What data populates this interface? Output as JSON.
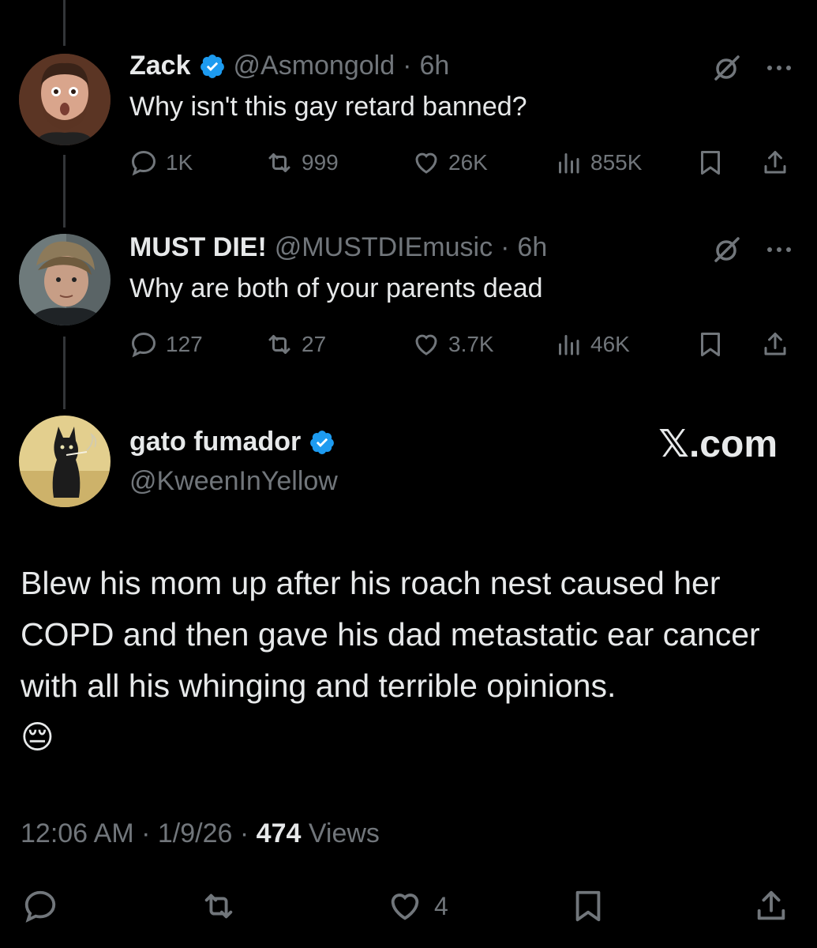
{
  "replies": [
    {
      "name": "Zack",
      "verified": true,
      "handle": "@Asmongold",
      "time": "6h",
      "text": "Why isn't this gay retard banned?",
      "stats": {
        "replies": "1K",
        "reposts": "999",
        "likes": "26K",
        "views": "855K"
      }
    },
    {
      "name": "MUST DIE!",
      "verified": false,
      "handle": "@MUSTDIEmusic",
      "time": "6h",
      "text": "Why are both of your parents dead",
      "stats": {
        "replies": "127",
        "reposts": "27",
        "likes": "3.7K",
        "views": "46K"
      }
    }
  ],
  "main": {
    "name": "gato fumador",
    "verified": true,
    "handle": "@KweenInYellow",
    "watermark": "𝕏.com",
    "text": "Blew his mom up after his roach nest caused her COPD and then gave his dad metastatic ear cancer with all his whinging and terrible opinions.",
    "emoji": "😔",
    "time": "12:06 AM",
    "date": "1/9/26",
    "views_count": "474",
    "views_label": "Views",
    "likes": "4"
  },
  "separator": "·",
  "colors": {
    "background": "#000000",
    "text": "#e7e9ea",
    "muted": "#71767b",
    "verified": "#1d9bf0",
    "line": "#333639"
  }
}
